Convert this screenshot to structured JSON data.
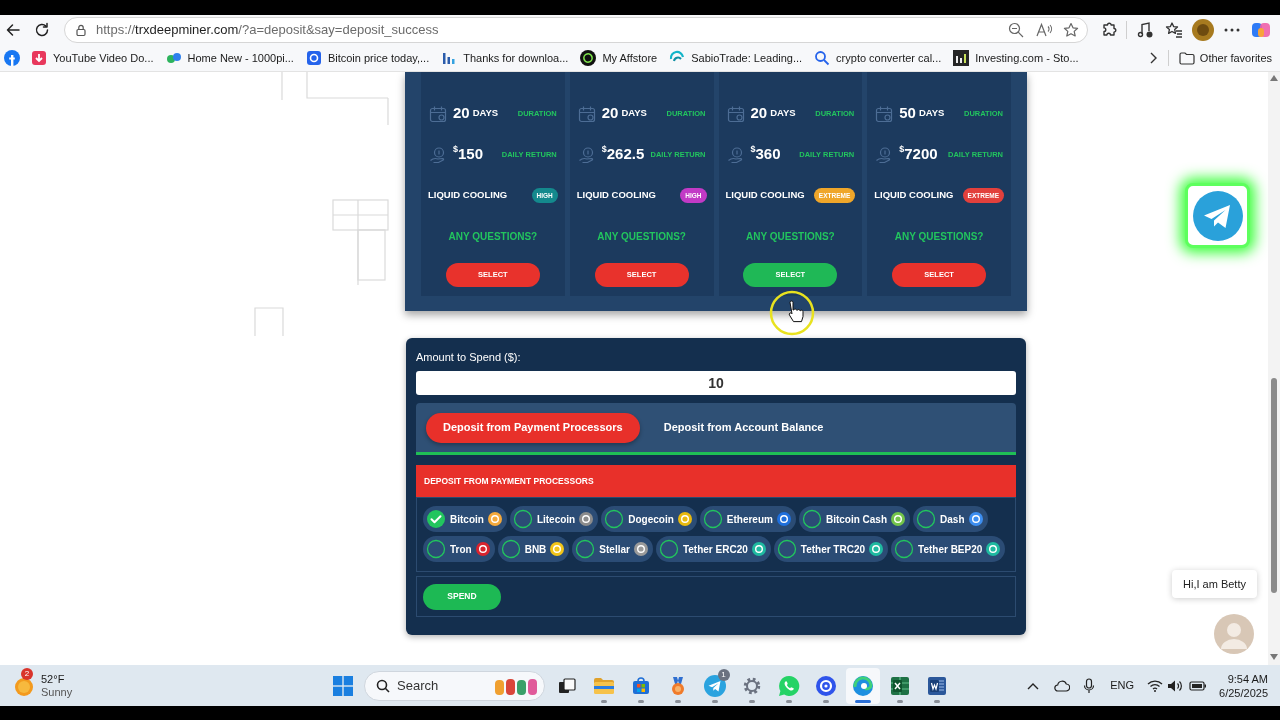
{
  "browser": {
    "url": {
      "scheme": "https://",
      "host": "trxdeepminer.com",
      "path": "/?a=deposit&say=deposit_success"
    },
    "bookmarks": [
      "YouTube Video Do...",
      "Home New - 1000pi...",
      "Bitcoin price today,...",
      "Thanks for downloa...",
      "My Affstore",
      "SabioTrade: Leading...",
      "crypto converter cal...",
      "Investing.com - Sto..."
    ],
    "other_favorites": "Other favorites"
  },
  "plans": [
    {
      "duration": "20",
      "duration_unit": "DAYS",
      "duration_label": "DURATION",
      "currency": "$",
      "daily_return": "150",
      "daily_return_label": "DAILY RETURN",
      "cooling_label": "LIQUID COOLING",
      "cooling_badge": {
        "text": "HIGH",
        "color": "#14898d"
      },
      "questions": "ANY QUESTIONS?",
      "button": "SELECT",
      "hovered": false
    },
    {
      "duration": "20",
      "duration_unit": "DAYS",
      "duration_label": "DURATION",
      "currency": "$",
      "daily_return": "262.5",
      "daily_return_label": "DAILY RETURN",
      "cooling_label": "LIQUID COOLING",
      "cooling_badge": {
        "text": "HIGH",
        "color": "#c23ac6"
      },
      "questions": "ANY QUESTIONS?",
      "button": "SELECT",
      "hovered": false
    },
    {
      "duration": "20",
      "duration_unit": "DAYS",
      "duration_label": "DURATION",
      "currency": "$",
      "daily_return": "360",
      "daily_return_label": "DAILY RETURN",
      "cooling_label": "LIQUID COOLING",
      "cooling_badge": {
        "text": "EXTREME",
        "color": "#efa62a"
      },
      "questions": "ANY QUESTIONS?",
      "button": "SELECT",
      "hovered": true
    },
    {
      "duration": "50",
      "duration_unit": "DAYS",
      "duration_label": "DURATION",
      "currency": "$",
      "daily_return": "7200",
      "daily_return_label": "DAILY RETURN",
      "cooling_label": "LIQUID COOLING",
      "cooling_badge": {
        "text": "EXTREME",
        "color": "#e2403c"
      },
      "questions": "ANY QUESTIONS?",
      "button": "SELECT",
      "hovered": false
    }
  ],
  "deposit": {
    "amount_label": "Amount to Spend ($):",
    "amount": "10",
    "tabs": [
      {
        "label": "Deposit from Payment Processors",
        "selected": true
      },
      {
        "label": "Deposit from Account Balance",
        "selected": false
      }
    ],
    "section_title": "DEPOSIT FROM PAYMENT PROCESSORS",
    "processors": [
      {
        "name": "Bitcoin",
        "selected": true,
        "color": "#f4a93c"
      },
      {
        "name": "Litecoin",
        "selected": false,
        "color": "#8c8c8c"
      },
      {
        "name": "Dogecoin",
        "selected": false,
        "color": "#e8b90f"
      },
      {
        "name": "Ethereum",
        "selected": false,
        "color": "#1f6fdc"
      },
      {
        "name": "Bitcoin Cash",
        "selected": false,
        "color": "#73c44a"
      },
      {
        "name": "Dash",
        "selected": false,
        "color": "#3d8ef0"
      },
      {
        "name": "Tron",
        "selected": false,
        "color": "#d9232e"
      },
      {
        "name": "BNB",
        "selected": false,
        "color": "#f0c419"
      },
      {
        "name": "Stellar",
        "selected": false,
        "color": "#9a9a9a"
      },
      {
        "name": "Tether ERC20",
        "selected": false,
        "color": "#1fb9a0"
      },
      {
        "name": "Tether TRC20",
        "selected": false,
        "color": "#1fb9a0"
      },
      {
        "name": "Tether BEP20",
        "selected": false,
        "color": "#1fb9a0"
      }
    ],
    "spend_button": "SPEND"
  },
  "chat": {
    "greeting": "Hi,I am Betty"
  },
  "taskbar": {
    "weather": {
      "badge": "2",
      "temperature": "52°F",
      "condition": "Sunny"
    },
    "search": {
      "placeholder": "Search"
    },
    "apps": [
      {
        "running": false,
        "active": false
      },
      {
        "running": true,
        "active": false
      },
      {
        "running": true,
        "active": false
      },
      {
        "running": true,
        "active": false
      },
      {
        "running": true,
        "active": false,
        "badge": "1"
      },
      {
        "running": true,
        "active": false
      },
      {
        "running": true,
        "active": false
      },
      {
        "running": true,
        "active": false
      },
      {
        "running": true,
        "active": true
      },
      {
        "running": true,
        "active": false
      },
      {
        "running": true,
        "active": false
      }
    ],
    "language": "ENG",
    "time": "9:54 AM",
    "date": "6/25/2025"
  }
}
